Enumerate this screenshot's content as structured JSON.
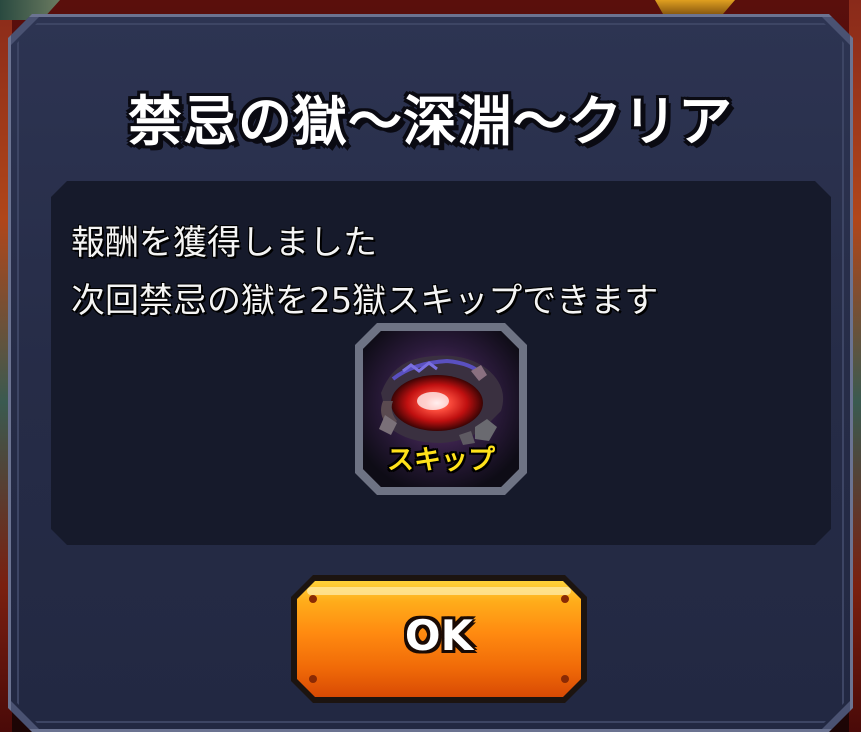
{
  "dialog": {
    "title": "禁忌の獄～深淵～クリア",
    "message_line1": "報酬を獲得しました",
    "message_line2": "次回禁忌の獄を25獄スキップできます",
    "reward_item": {
      "label": "スキップ",
      "icon": "portal-vortex-icon"
    },
    "ok_button_label": "OK"
  },
  "colors": {
    "dialog_bg": "#262c47",
    "content_bg": "#161a2b",
    "button_orange": "#ff8a10",
    "icon_label_yellow": "#ffe21a",
    "portal_red": "#e0201a"
  }
}
